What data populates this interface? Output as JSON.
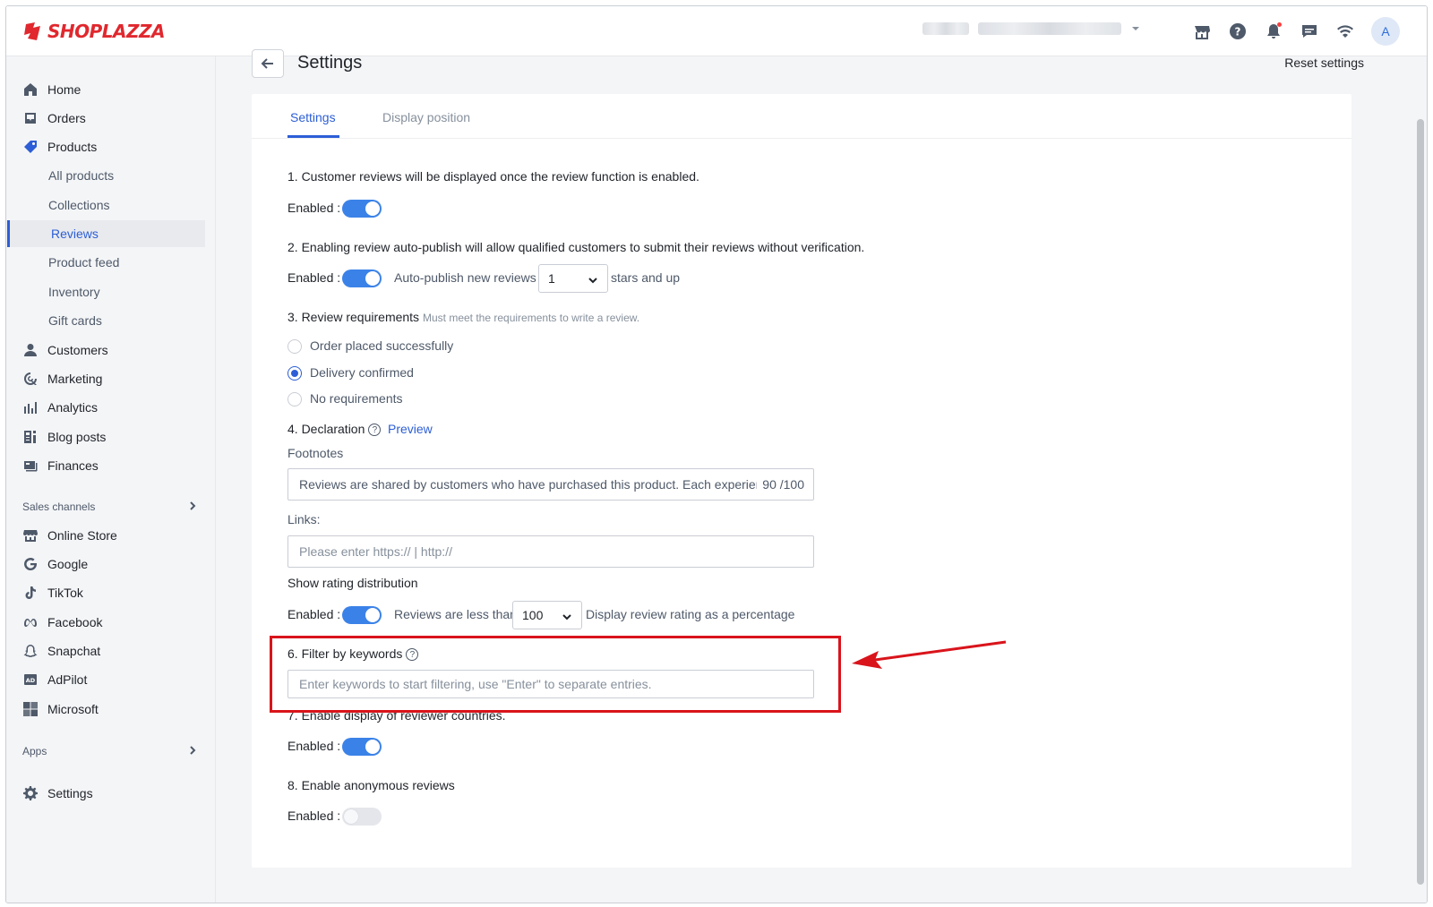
{
  "brand": {
    "name": "SHOPLAZZA",
    "color": "#e0282e",
    "accent": "#2c5ed6"
  },
  "topbar": {
    "icons": [
      "store-icon",
      "help-icon",
      "bell-icon",
      "chat-icon",
      "wifi-icon"
    ],
    "avatar_letter": "A"
  },
  "sidebar": {
    "items": [
      {
        "label": "Home",
        "icon": "home-icon"
      },
      {
        "label": "Orders",
        "icon": "orders-icon"
      },
      {
        "label": "Products",
        "icon": "tag-icon"
      },
      {
        "label": "All products"
      },
      {
        "label": "Collections"
      },
      {
        "label": "Reviews"
      },
      {
        "label": "Product feed"
      },
      {
        "label": "Inventory"
      },
      {
        "label": "Gift cards"
      },
      {
        "label": "Customers",
        "icon": "person-icon"
      },
      {
        "label": "Marketing",
        "icon": "marketing-icon"
      },
      {
        "label": "Analytics",
        "icon": "bar-chart-icon"
      },
      {
        "label": "Blog posts",
        "icon": "blog-icon"
      },
      {
        "label": "Finances",
        "icon": "finance-icon"
      }
    ],
    "sales_channels_label": "Sales channels",
    "channels": [
      {
        "label": "Online Store",
        "icon": "store-icon"
      },
      {
        "label": "Google",
        "icon": "google-icon"
      },
      {
        "label": "TikTok",
        "icon": "tiktok-icon"
      },
      {
        "label": "Facebook",
        "icon": "meta-icon"
      },
      {
        "label": "Snapchat",
        "icon": "snapchat-icon"
      },
      {
        "label": "AdPilot",
        "icon": "adpilot-icon"
      },
      {
        "label": "Microsoft",
        "icon": "microsoft-icon"
      }
    ],
    "apps_label": "Apps",
    "settings_label": "Settings"
  },
  "header": {
    "title": "Settings",
    "reset_label": "Reset settings"
  },
  "tabs": [
    {
      "label": "Settings"
    },
    {
      "label": "Display position"
    }
  ],
  "content": {
    "s1_text": "1. Customer reviews will be displayed once the review function is enabled.",
    "enabled_label": "Enabled :",
    "s2_text": "2. Enabling review auto-publish will allow qualified customers to submit their reviews without verification.",
    "auto_publish_label": "Auto-publish new reviews",
    "auto_publish_value": "1",
    "stars_suffix": "stars and up",
    "s3_title": "3. Review requirements",
    "s3_hint": "Must meet the requirements to write a review.",
    "req_options": [
      "Order placed successfully",
      "Delivery confirmed",
      "No requirements"
    ],
    "s4_title": "4. Declaration",
    "preview_label": "Preview",
    "footnotes_label": "Footnotes",
    "footnotes_value": "Reviews are shared by customers who have purchased this product. Each experience",
    "footnotes_count": "90 /100",
    "links_label": "Links:",
    "links_placeholder": "Please enter https:// | http://",
    "rating_dist_label": "Show rating distribution",
    "reviews_less_label": "Reviews are less than",
    "reviews_less_value": "100",
    "percentage_label": "Display review rating as a percentage",
    "s6_title": "6. Filter by keywords",
    "keywords_placeholder": "Enter keywords to start filtering, use \"Enter\" to separate entries.",
    "s7_title": "7. Enable display of reviewer countries.",
    "s8_title": "8. Enable anonymous reviews"
  }
}
